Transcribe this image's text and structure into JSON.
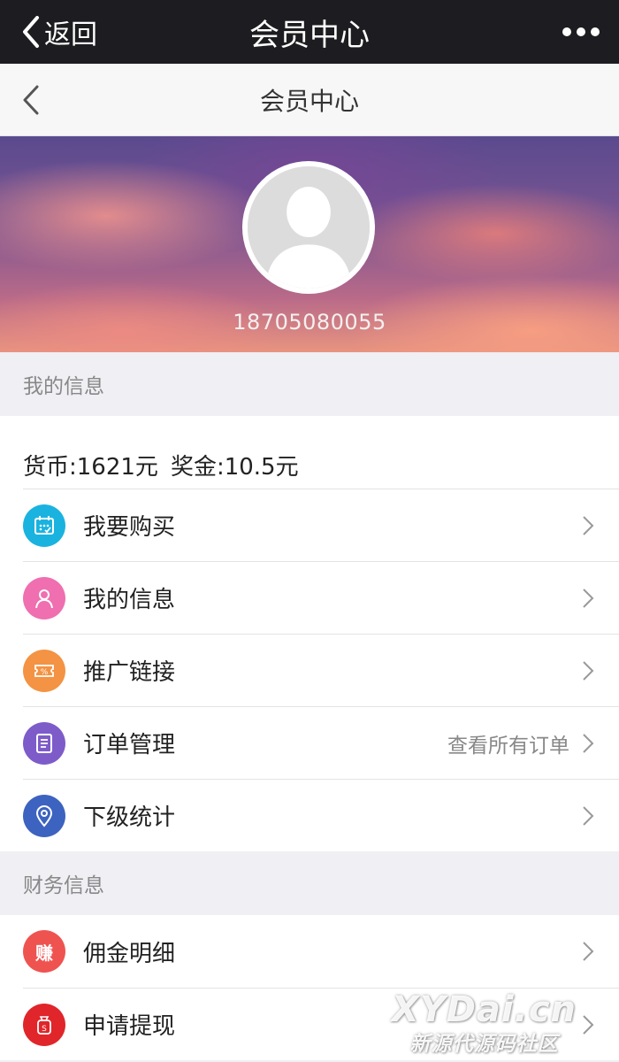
{
  "wechat_bar": {
    "back_label": "返回",
    "title": "会员中心",
    "more_icon": "ellipsis-icon"
  },
  "nav": {
    "title": "会员中心",
    "back_icon": "chevron-left-icon"
  },
  "profile": {
    "phone": "18705080055",
    "avatar_icon": "default-avatar-icon"
  },
  "my_info": {
    "header": "我的信息",
    "balance": {
      "currency": "货币:1621元",
      "bonus": "奖金:10.5元"
    },
    "items": [
      {
        "label": "我要购买",
        "icon": "calendar-icon",
        "color": "#1ab3e0",
        "aside": ""
      },
      {
        "label": "我的信息",
        "icon": "user-icon",
        "color": "#ef6fb0",
        "aside": ""
      },
      {
        "label": "推广链接",
        "icon": "coupon-icon",
        "color": "#f39343",
        "aside": ""
      },
      {
        "label": "订单管理",
        "icon": "document-icon",
        "color": "#7d5cc9",
        "aside": "查看所有订单"
      },
      {
        "label": "下级统计",
        "icon": "location-icon",
        "color": "#3d63c0",
        "aside": ""
      }
    ]
  },
  "finance": {
    "header": "财务信息",
    "items": [
      {
        "label": "佣金明细",
        "icon": "earn-icon",
        "color": "#ef5350",
        "badge": "赚"
      },
      {
        "label": "申请提现",
        "icon": "money-bag-icon",
        "color": "#e0262b"
      }
    ]
  },
  "watermark": {
    "line1": "XYDai.cn",
    "line2": "新源代源码社区"
  }
}
